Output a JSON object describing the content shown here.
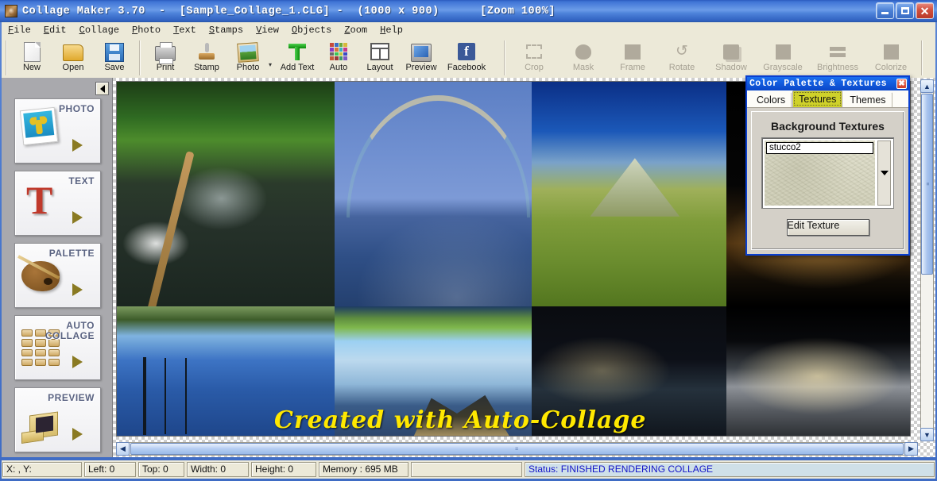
{
  "window": {
    "title": "Collage Maker 3.70  -  [Sample_Collage_1.CLG] -  (1000 x 900)      [Zoom 100%]",
    "app_name": "Collage Maker 3.70",
    "document": "Sample_Collage_1.CLG",
    "canvas_size": "(1000 x 900)",
    "zoom": "[Zoom 100%]",
    "minimize": "_",
    "maximize": "[]",
    "close": "X",
    "accent_color": "#0a46c8"
  },
  "menu": {
    "items": [
      {
        "first": "F",
        "rest": "ile"
      },
      {
        "first": "E",
        "rest": "dit"
      },
      {
        "first": "C",
        "rest": "ollage"
      },
      {
        "first": "P",
        "rest": "hoto"
      },
      {
        "first": "T",
        "rest": "ext"
      },
      {
        "first": "S",
        "rest": "tamps"
      },
      {
        "first": "V",
        "rest": "iew"
      },
      {
        "first": "O",
        "rest": "bjects"
      },
      {
        "first": "Z",
        "rest": "oom"
      },
      {
        "first": "H",
        "rest": "elp"
      }
    ]
  },
  "toolbar": {
    "enabled": [
      {
        "label": "New",
        "icon": "new-document-icon"
      },
      {
        "label": "Open",
        "icon": "open-folder-icon"
      },
      {
        "label": "Save",
        "icon": "save-disk-icon"
      },
      {
        "label": "Print",
        "icon": "printer-icon"
      },
      {
        "label": "Stamp",
        "icon": "stamp-icon"
      },
      {
        "label": "Photo",
        "icon": "photo-icon"
      },
      {
        "label": "Add Text",
        "icon": "add-text-icon"
      },
      {
        "label": "Auto",
        "icon": "auto-grid-icon"
      },
      {
        "label": "Layout",
        "icon": "layout-icon"
      },
      {
        "label": "Preview",
        "icon": "preview-monitor-icon"
      },
      {
        "label": "Facebook",
        "icon": "facebook-icon"
      }
    ],
    "disabled": [
      {
        "label": "Crop",
        "icon": "crop-icon"
      },
      {
        "label": "Mask",
        "icon": "mask-icon"
      },
      {
        "label": "Frame",
        "icon": "frame-icon"
      },
      {
        "label": "Rotate",
        "icon": "rotate-icon"
      },
      {
        "label": "Shadow",
        "icon": "shadow-icon"
      },
      {
        "label": "Grayscale",
        "icon": "grayscale-icon"
      },
      {
        "label": "Brightness",
        "icon": "brightness-icon"
      },
      {
        "label": "Colorize",
        "icon": "colorize-icon"
      }
    ],
    "photo_dropdown": "▾"
  },
  "sidebar": {
    "collapse": "◀",
    "buttons": [
      {
        "label": "PHOTO",
        "icon": "photo-thumbnail-icon"
      },
      {
        "label": "TEXT",
        "icon": "text-letter-icon"
      },
      {
        "label": "PALETTE",
        "icon": "palette-icon"
      },
      {
        "label": "AUTO COLLAGE",
        "line1": "AUTO",
        "line2": "COLLAGE",
        "icon": "auto-collage-grid-icon"
      },
      {
        "label": "PREVIEW",
        "icon": "preview-monitor-icon"
      }
    ]
  },
  "canvas": {
    "watermark": "Created with Auto-Collage",
    "watermark_color": "#ffe800",
    "photos": [
      {
        "name": "waterfall-mossy-forest"
      },
      {
        "name": "rainbow-over-lake"
      },
      {
        "name": "green-mountain-valley"
      },
      {
        "name": "dark-sunset-horizon"
      },
      {
        "name": "driftwood-in-water"
      },
      {
        "name": "blue-sky-through-trees"
      },
      {
        "name": "rocky-mountain-shore"
      },
      {
        "name": "golden-sunlit-beach"
      }
    ],
    "scroll": {
      "up": "▲",
      "down": "▼",
      "left": "◀",
      "right": "▶",
      "grip": "≡"
    }
  },
  "palette_window": {
    "title": "Color Palette & Textures",
    "close": "✖",
    "tabs": [
      {
        "label": "Colors",
        "active": false
      },
      {
        "label": "Textures",
        "active": true
      },
      {
        "label": "Themes",
        "active": false
      }
    ],
    "section_heading": "Background Textures",
    "texture_name": "stucco2",
    "dropdown_arrow": "▼",
    "edit_button": "Edit Texture"
  },
  "statusbar": {
    "coords": "X: , Y:",
    "left": "Left: 0",
    "top": "Top: 0",
    "width": "Width: 0",
    "height": "Height: 0",
    "memory": "Memory : 695 MB",
    "spare": "",
    "status": "Status: FINISHED RENDERING COLLAGE",
    "status_color": "#1414c8"
  }
}
